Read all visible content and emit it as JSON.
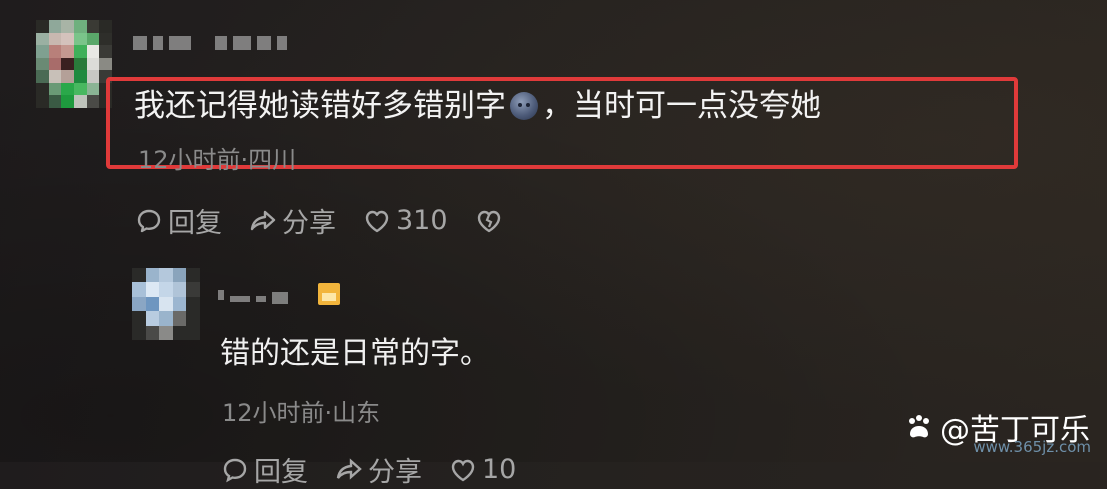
{
  "comment": {
    "text_before_emoji": "我还记得她读错好多错别字",
    "emoji": "crying-face-emoji",
    "text_after_emoji": "，当时可一点没夸她",
    "meta": "12小时前·四川",
    "actions": {
      "reply_label": "回复",
      "share_label": "分享",
      "like_count": "310"
    }
  },
  "reply": {
    "text": "错的还是日常的字。",
    "meta": "12小时前·山东",
    "actions": {
      "reply_label": "回复",
      "share_label": "分享",
      "like_count": "10"
    }
  },
  "watermark": {
    "handle": "@苦丁可乐",
    "site": "www.365jz.com"
  },
  "colors": {
    "highlight_border": "#e03a3a",
    "meta_text": "#8a8a8a",
    "action_text": "#a6a6a6",
    "vip_badge": "#f2b53c"
  }
}
